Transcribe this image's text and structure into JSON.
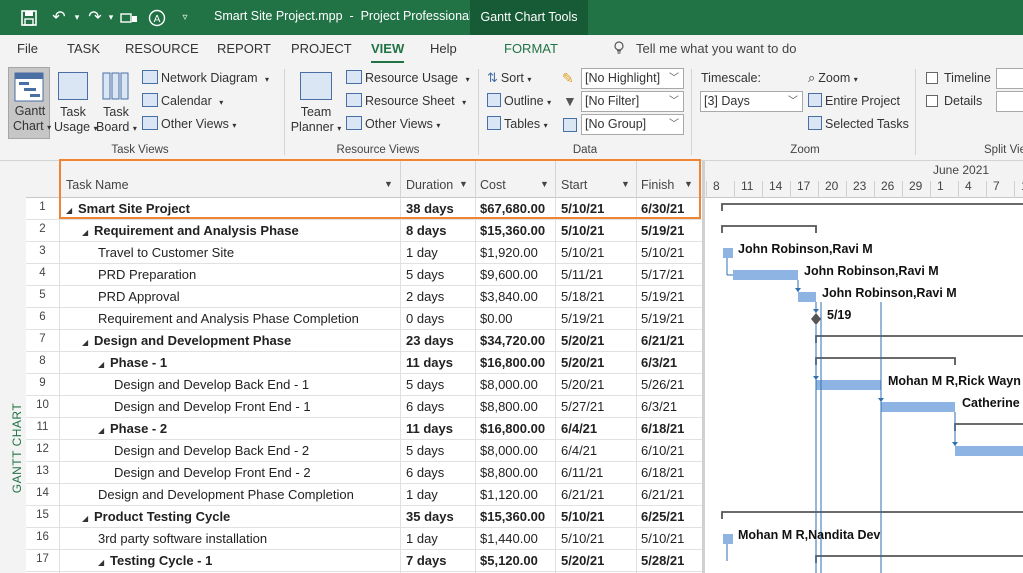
{
  "titlebar": {
    "file_name": "Smart Site Project.mpp",
    "separator": "-",
    "app_name": "Project Professional",
    "context_tab": "Gantt Chart Tools"
  },
  "tabs": [
    "File",
    "TASK",
    "RESOURCE",
    "REPORT",
    "PROJECT",
    "VIEW",
    "Help",
    "FORMAT"
  ],
  "tell_me": "Tell me what you want to do",
  "ribbon": {
    "task_views": {
      "gantt_chart": [
        "Gantt",
        "Chart"
      ],
      "task_usage": [
        "Task",
        "Usage"
      ],
      "task_board": [
        "Task",
        "Board"
      ],
      "network_diagram": "Network Diagram",
      "calendar": "Calendar",
      "other_views": "Other Views",
      "group_label": "Task Views"
    },
    "resource_views": {
      "team_planner": [
        "Team",
        "Planner"
      ],
      "resource_usage": "Resource Usage",
      "resource_sheet": "Resource Sheet",
      "other_views": "Other Views",
      "group_label": "Resource Views"
    },
    "data": {
      "sort": "Sort",
      "outline": "Outline",
      "tables": "Tables",
      "highlight": "[No Highlight]",
      "filter": "[No Filter]",
      "group": "[No Group]",
      "group_label": "Data"
    },
    "zoom": {
      "timescale_label": "Timescale:",
      "timescale_value": "[3] Days",
      "zoom": "Zoom",
      "entire_project": "Entire Project",
      "selected_tasks": "Selected Tasks",
      "group_label": "Zoom"
    },
    "split_view": {
      "timeline": "Timeline",
      "details": "Details",
      "group_label": "Split Vie"
    }
  },
  "side_label": "GANTT CHART",
  "columns": [
    "Task Name",
    "Duration",
    "Cost",
    "Start",
    "Finish"
  ],
  "tasks": [
    {
      "id": "1",
      "name": "Smart Site Project",
      "duration": "38 days",
      "cost": "$67,680.00",
      "start": "5/10/21",
      "finish": "6/30/21",
      "summary": true,
      "level": 0
    },
    {
      "id": "2",
      "name": "Requirement and Analysis Phase",
      "duration": "8 days",
      "cost": "$15,360.00",
      "start": "5/10/21",
      "finish": "5/19/21",
      "summary": true,
      "level": 1
    },
    {
      "id": "3",
      "name": "Travel to Customer Site",
      "duration": "1 day",
      "cost": "$1,920.00",
      "start": "5/10/21",
      "finish": "5/10/21",
      "summary": false,
      "level": 2
    },
    {
      "id": "4",
      "name": "PRD Preparation",
      "duration": "5 days",
      "cost": "$9,600.00",
      "start": "5/11/21",
      "finish": "5/17/21",
      "summary": false,
      "level": 2
    },
    {
      "id": "5",
      "name": "PRD Approval",
      "duration": "2 days",
      "cost": "$3,840.00",
      "start": "5/18/21",
      "finish": "5/19/21",
      "summary": false,
      "level": 2
    },
    {
      "id": "6",
      "name": "Requirement and Analysis Phase Completion",
      "duration": "0 days",
      "cost": "$0.00",
      "start": "5/19/21",
      "finish": "5/19/21",
      "summary": false,
      "level": 2
    },
    {
      "id": "7",
      "name": "Design and Development Phase",
      "duration": "23 days",
      "cost": "$34,720.00",
      "start": "5/20/21",
      "finish": "6/21/21",
      "summary": true,
      "level": 1
    },
    {
      "id": "8",
      "name": "Phase - 1",
      "duration": "11 days",
      "cost": "$16,800.00",
      "start": "5/20/21",
      "finish": "6/3/21",
      "summary": true,
      "level": 2
    },
    {
      "id": "9",
      "name": "Design and Develop Back End - 1",
      "duration": "5 days",
      "cost": "$8,000.00",
      "start": "5/20/21",
      "finish": "5/26/21",
      "summary": false,
      "level": 3
    },
    {
      "id": "10",
      "name": "Design and Develop Front End - 1",
      "duration": "6 days",
      "cost": "$8,800.00",
      "start": "5/27/21",
      "finish": "6/3/21",
      "summary": false,
      "level": 3
    },
    {
      "id": "11",
      "name": "Phase - 2",
      "duration": "11 days",
      "cost": "$16,800.00",
      "start": "6/4/21",
      "finish": "6/18/21",
      "summary": true,
      "level": 2
    },
    {
      "id": "12",
      "name": "Design and Develop Back End - 2",
      "duration": "5 days",
      "cost": "$8,000.00",
      "start": "6/4/21",
      "finish": "6/10/21",
      "summary": false,
      "level": 3
    },
    {
      "id": "13",
      "name": "Design and Develop Front End - 2",
      "duration": "6 days",
      "cost": "$8,800.00",
      "start": "6/11/21",
      "finish": "6/18/21",
      "summary": false,
      "level": 3
    },
    {
      "id": "14",
      "name": "Design and Development Phase Completion",
      "duration": "1 day",
      "cost": "$1,120.00",
      "start": "6/21/21",
      "finish": "6/21/21",
      "summary": false,
      "level": 2
    },
    {
      "id": "15",
      "name": "Product Testing Cycle",
      "duration": "35 days",
      "cost": "$15,360.00",
      "start": "5/10/21",
      "finish": "6/25/21",
      "summary": true,
      "level": 1
    },
    {
      "id": "16",
      "name": "3rd party software installation",
      "duration": "1 day",
      "cost": "$1,440.00",
      "start": "5/10/21",
      "finish": "5/10/21",
      "summary": false,
      "level": 2
    },
    {
      "id": "17",
      "name": "Testing Cycle  - 1",
      "duration": "7 days",
      "cost": "$5,120.00",
      "start": "5/20/21",
      "finish": "5/28/21",
      "summary": true,
      "level": 2
    }
  ],
  "timescale": {
    "month_label": "June 2021",
    "ticks": [
      "8",
      "11",
      "14",
      "17",
      "20",
      "23",
      "26",
      "29",
      "1",
      "4",
      "7",
      "1"
    ]
  },
  "gantt_labels": {
    "r3": "John Robinson,Ravi M",
    "r4": "John Robinson,Ravi M",
    "r5": "John Robinson,Ravi M",
    "r6": "5/19",
    "r9": "Mohan M R,Rick Wayn",
    "r10": "Catherine",
    "r16": "Mohan M R,Nandita Dev"
  },
  "colors": {
    "title_green": "#217346",
    "highlight_orange": "#ee8434",
    "bar_blue": "#8db4e2"
  }
}
